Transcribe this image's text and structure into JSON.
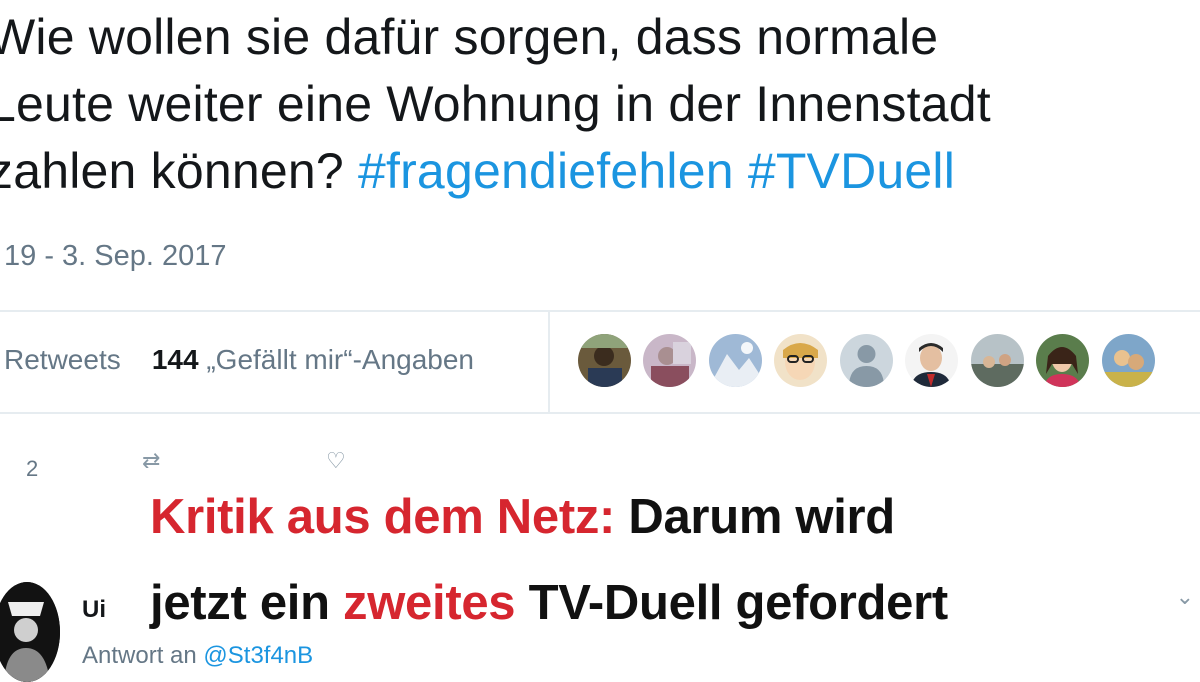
{
  "tweet": {
    "line1": "Wie wollen sie dafür sorgen, dass normale",
    "line2": "Leute weiter eine Wohnung in der Innenstadt",
    "line3_prefix": "zahlen können?",
    "hashtags": [
      "#fragendiefehlen",
      "#TVDuell"
    ],
    "timestamp": "19 - 3. Sep. 2017"
  },
  "stats": {
    "retweets_label": "Retweets",
    "likes_count": "144",
    "likes_label": "„Gefällt mir“-Angaben",
    "avatar_count": 9
  },
  "actions": {
    "reply_count": "2"
  },
  "overlay": {
    "headline_red_1": "Kritik aus dem Netz:",
    "headline_black_1": "Darum wird",
    "headline_black_2": "jetzt ein",
    "headline_red_2": "zweites",
    "headline_black_3": "TV-Duell gefordert"
  },
  "reply": {
    "user_partial": "Ui",
    "reply_prefix": "Antwort an",
    "mention": "@St3f4nB"
  },
  "colors": {
    "hashtag": "#1b95e0",
    "accent_red": "#d6262f",
    "muted": "#657786"
  }
}
